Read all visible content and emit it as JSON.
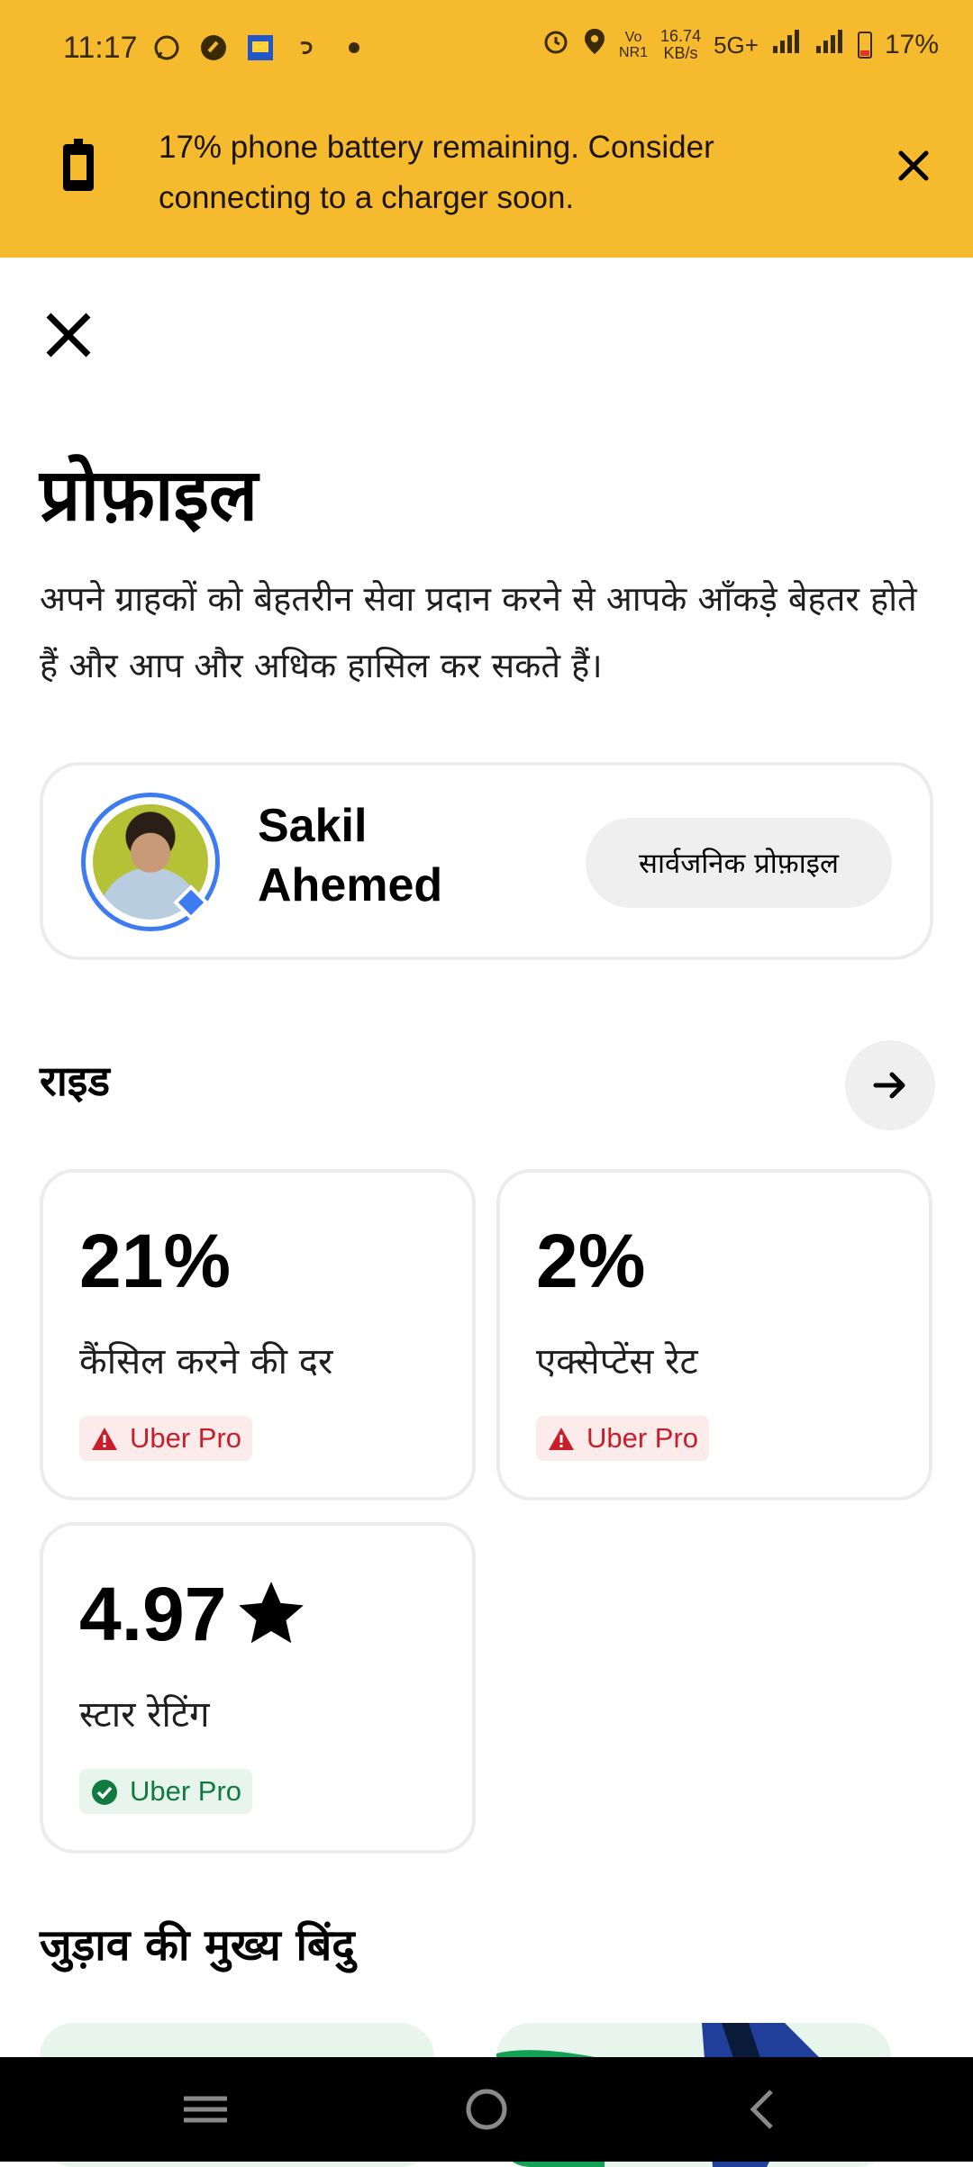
{
  "status_bar": {
    "time": "11:17",
    "network_speed_value": "16.74",
    "network_speed_unit": "KB/s",
    "volte_top": "Vo",
    "volte_bottom": "NR1",
    "network_type": "5G+",
    "battery_percent": "17%"
  },
  "banner": {
    "message": "17% phone battery remaining. Consider connecting to a charger soon."
  },
  "page": {
    "title": "प्रोफ़ाइल",
    "subtitle": "अपने ग्राहकों को बेहतरीन सेवा प्रदान करने से आपके आँकड़े बेहतर होते हैं और आप और अधिक हासिल कर सकते हैं।"
  },
  "profile": {
    "first_name": "Sakil",
    "last_name": "Ahemed",
    "public_profile_label": "सार्वजनिक प्रोफ़ाइल"
  },
  "rides_section": {
    "title": "राइड",
    "stats": [
      {
        "value": "21%",
        "label": "कैंसिल करने की दर",
        "badge": "Uber Pro",
        "status": "warning"
      },
      {
        "value": "2%",
        "label": "एक्सेप्टेंस रेट",
        "badge": "Uber Pro",
        "status": "warning"
      },
      {
        "value": "4.97",
        "label": "स्टार रेटिंग",
        "badge": "Uber Pro",
        "status": "ok"
      }
    ]
  },
  "engagement_section": {
    "title": "जुड़ाव की मुख्य बिंदु"
  },
  "colors": {
    "banner_bg": "#F6BA2F",
    "accent_blue": "#3C7BF0",
    "warning_red": "#C81E2A",
    "ok_green": "#117A3E"
  }
}
